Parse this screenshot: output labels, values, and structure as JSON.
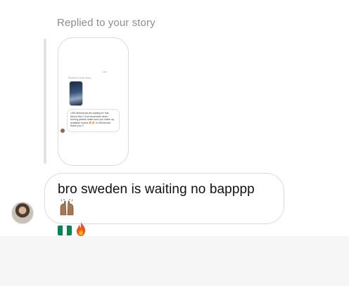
{
  "reply_context": {
    "label": "Replied to your story"
  },
  "story_preview": {
    "reply_label": "Replied to your story",
    "caption_lines": [
      "USA Minnesota we waiting for this.",
      "Album Bio !! And remember when",
      "touring please make sure you make up",
      "available tickets",
      "in Minnesota",
      "thank you !!"
    ],
    "caption_highlight": "🔥🔥"
  },
  "message": {
    "text": "bro sweden is waiting no bapppp",
    "trailing_emoji": "raising-hands-icon",
    "emoji_line": [
      "nigeria-flag-icon",
      "fire-icon"
    ]
  },
  "colors": {
    "label_gray": "#8e8e8e",
    "bubble_border": "#dbdbdb",
    "flag_green": "#008751",
    "flag_white": "#ffffff",
    "footer_bg": "#f6f6f6"
  }
}
